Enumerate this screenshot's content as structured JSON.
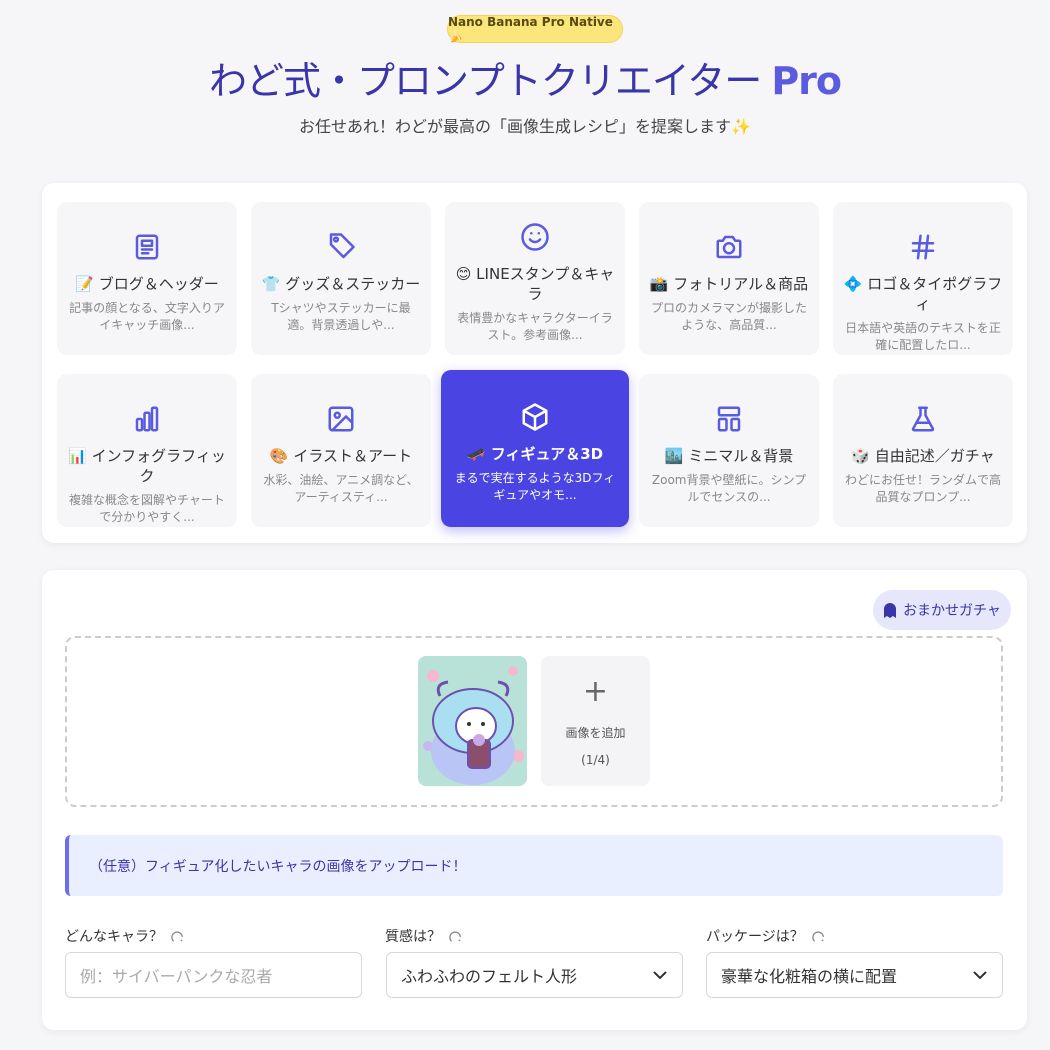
{
  "header": {
    "badge": "Nano Banana Pro Native🍌",
    "title": "わど式・プロンプトクリエイター",
    "title_pro": "Pro",
    "subtitle": "お任せあれ！わどが最高の「画像生成レシピ」を提案します✨"
  },
  "categories": [
    {
      "icon": "newspaper-icon",
      "name": "📝 ブログ＆ヘッダー",
      "desc": "記事の顔となる、文字入りアイキャッチ画像..."
    },
    {
      "icon": "tag-icon",
      "name": "👕 グッズ＆ステッカー",
      "desc": "Tシャツやステッカーに最適。背景透過しや..."
    },
    {
      "icon": "smile-icon",
      "name": "😊 LINEスタンプ＆キャラ",
      "desc": "表情豊かなキャラクターイラスト。参考画像..."
    },
    {
      "icon": "camera-icon",
      "name": "📸 フォトリアル＆商品",
      "desc": "プロのカメラマンが撮影したような、高品質..."
    },
    {
      "icon": "hash-icon",
      "name": "💠 ロゴ＆タイポグラフィ",
      "desc": "日本語や英語のテキストを正確に配置したロ..."
    },
    {
      "icon": "bar-chart-icon",
      "name": "📊 インフォグラフィック",
      "desc": "複雑な概念を図解やチャートで分かりやすく..."
    },
    {
      "icon": "image-icon",
      "name": "🎨 イラスト＆アート",
      "desc": "水彩、油絵、アニメ調など、アーティスティ..."
    },
    {
      "icon": "cube-icon",
      "name": "🛹 フィギュア＆3D",
      "desc": "まるで実在するような3Dフィギュアやオモ...",
      "active": true
    },
    {
      "icon": "layout-icon",
      "name": "🏙️ ミニマル＆背景",
      "desc": "Zoom背景や壁紙に。シンプルでセンスの..."
    },
    {
      "icon": "flask-icon",
      "name": "🎲 自由記述／ガチャ",
      "desc": "わどにお任せ！ランダムで高品質なプロンプ..."
    }
  ],
  "gacha_label": "おまかせガチャ",
  "upload": {
    "add_label": "画像を追加",
    "count": "(1/4)"
  },
  "hint": "（任意）フィギュア化したいキャラの画像をアップロード！",
  "form": {
    "character_label": "どんなキャラ？",
    "character_placeholder": "例：サイバーパンクな忍者",
    "texture_label": "質感は？",
    "texture_value": "ふわふわのフェルト人形",
    "package_label": "パッケージは？",
    "package_value": "豪華な化粧箱の横に配置"
  },
  "colors": {
    "accent": "#4a44e2",
    "badge": "#fbe67c",
    "title": "#3a35a8"
  }
}
